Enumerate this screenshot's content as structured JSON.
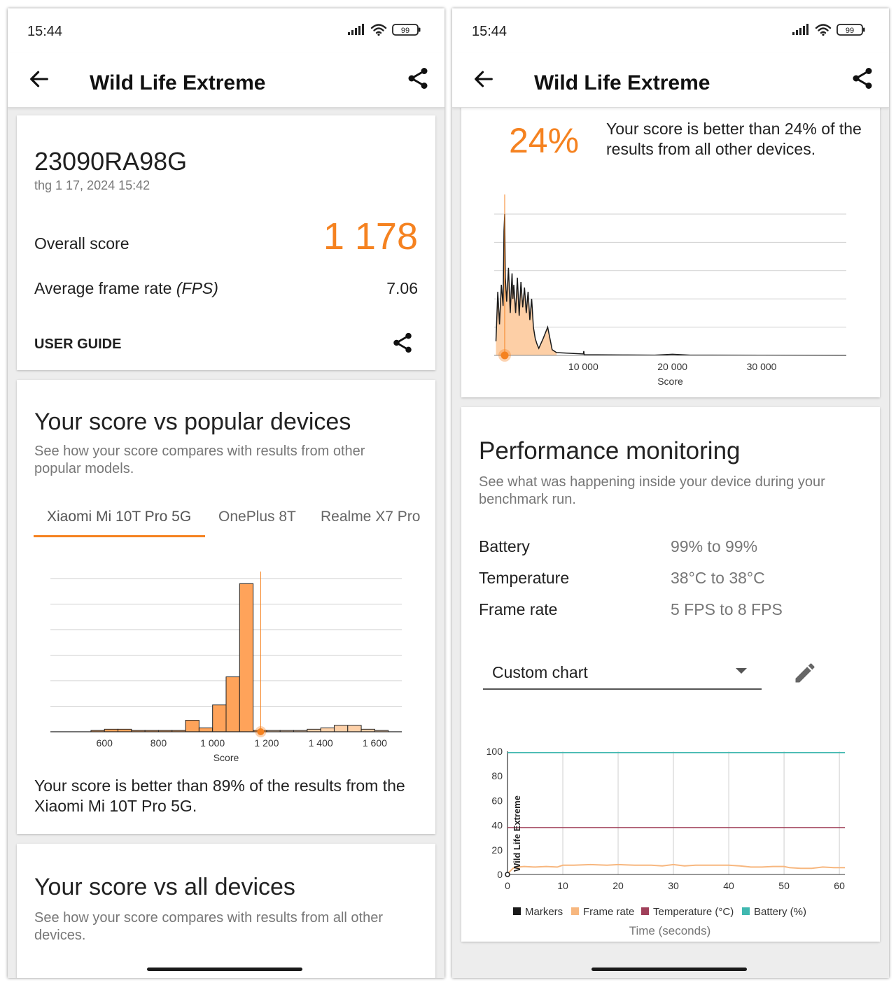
{
  "status": {
    "time": "15:44",
    "battery": "99"
  },
  "app": {
    "title": "Wild Life Extreme"
  },
  "result": {
    "device": "23090RA98G",
    "date": "thg 1 17, 2024 15:42",
    "overall_label": "Overall score",
    "overall_value": "1 178",
    "fps_label": "Average frame rate",
    "fps_unit": "(FPS)",
    "fps_value": "7.06",
    "user_guide": "USER GUIDE"
  },
  "popular": {
    "title": "Your score vs popular devices",
    "description": "See how your score compares with results from other popular models.",
    "tabs": [
      "Xiaomi Mi 10T Pro 5G",
      "OnePlus 8T",
      "Realme X7 Pro"
    ],
    "active_tab": 0,
    "summary": "Your score is better than 89% of the results from the Xiaomi Mi 10T Pro 5G."
  },
  "all_devices": {
    "title": "Your score vs all devices",
    "description": "See how your score compares with results from all other devices.",
    "percent": "24%",
    "summary": "Your score is better than 24% of the results from all other devices."
  },
  "performance": {
    "title": "Performance monitoring",
    "description": "See what was happening inside your device during your benchmark run.",
    "rows": [
      {
        "label": "Battery",
        "value": "99% to 99%"
      },
      {
        "label": "Temperature",
        "value": "38°C to 38°C"
      },
      {
        "label": "Frame rate",
        "value": "5 FPS to 8 FPS"
      }
    ],
    "dropdown_value": "Custom chart"
  },
  "colors": {
    "accent": "#f58220",
    "bar_fill": "#ffa35a",
    "temperature": "#a0405a",
    "battery": "#40b8b0",
    "framerate": "#f7b77f",
    "markers": "#1a1a1a"
  },
  "chart_data": [
    {
      "type": "bar",
      "xlabel": "Score",
      "x_ticks": [
        600,
        800,
        1000,
        1200,
        1400,
        1600
      ],
      "bin_width": 50,
      "bins": [
        {
          "x": 425,
          "v": 0
        },
        {
          "x": 475,
          "v": 0
        },
        {
          "x": 525,
          "v": 0
        },
        {
          "x": 575,
          "v": 0.5
        },
        {
          "x": 625,
          "v": 1
        },
        {
          "x": 675,
          "v": 1
        },
        {
          "x": 725,
          "v": 0.5
        },
        {
          "x": 775,
          "v": 0.5
        },
        {
          "x": 825,
          "v": 0.5
        },
        {
          "x": 875,
          "v": 0.5
        },
        {
          "x": 925,
          "v": 4.5
        },
        {
          "x": 975,
          "v": 1.5
        },
        {
          "x": 1025,
          "v": 10.5
        },
        {
          "x": 1075,
          "v": 21.5
        },
        {
          "x": 1125,
          "v": 58
        },
        {
          "x": 1175,
          "v": 0.5
        },
        {
          "x": 1225,
          "v": 0.5
        },
        {
          "x": 1275,
          "v": 0.5
        },
        {
          "x": 1325,
          "v": 0.5
        },
        {
          "x": 1375,
          "v": 1
        },
        {
          "x": 1425,
          "v": 1.5
        },
        {
          "x": 1475,
          "v": 2.5
        },
        {
          "x": 1525,
          "v": 2.5
        },
        {
          "x": 1575,
          "v": 1
        },
        {
          "x": 1625,
          "v": 0.5
        },
        {
          "x": 1675,
          "v": 0
        }
      ],
      "xlim": [
        400,
        1700
      ],
      "ylim": [
        0,
        60
      ],
      "marker_score": 1178,
      "grid": true
    },
    {
      "type": "line",
      "xlabel": "Score",
      "x_ticks": [
        10000,
        20000,
        30000
      ],
      "xlim": [
        0,
        39500
      ],
      "ylim": [
        0,
        100
      ],
      "marker_score": 1178,
      "x": [
        200,
        400,
        600,
        800,
        1000,
        1100,
        1178,
        1250,
        1400,
        1600,
        1800,
        2000,
        2100,
        2200,
        2400,
        2600,
        2800,
        3000,
        3200,
        3400,
        3600,
        3800,
        4000,
        4200,
        4400,
        4600,
        4800,
        5000,
        5500,
        6000,
        6500,
        7000,
        10000,
        10050,
        10100,
        15000,
        18000,
        20000,
        22000,
        30000,
        39500
      ],
      "y": [
        10,
        45,
        22,
        50,
        35,
        88,
        100,
        55,
        38,
        62,
        30,
        58,
        40,
        50,
        30,
        55,
        28,
        52,
        34,
        48,
        30,
        45,
        25,
        40,
        20,
        12,
        8,
        5,
        12,
        20,
        4,
        2,
        1,
        3,
        0.5,
        0.3,
        0.2,
        0.8,
        0.2,
        0.1,
        0
      ],
      "grid": true
    },
    {
      "type": "line",
      "xlabel": "Time (seconds)",
      "x_ticks": [
        0,
        10,
        20,
        30,
        40,
        50,
        60
      ],
      "y_ticks": [
        0,
        20,
        40,
        60,
        80,
        100
      ],
      "xlim": [
        0,
        61
      ],
      "ylim": [
        0,
        100
      ],
      "marker_label": "Wild Life Extreme",
      "legend": [
        "Markers",
        "Frame rate",
        "Temperature (°C)",
        "Battery (%)"
      ],
      "series": [
        {
          "name": "Battery (%)",
          "x": [
            0,
            61
          ],
          "values": [
            99,
            99
          ]
        },
        {
          "name": "Temperature (°C)",
          "x": [
            0,
            61
          ],
          "values": [
            38,
            38
          ]
        },
        {
          "name": "Frame rate",
          "x": [
            0,
            1,
            2,
            3,
            5,
            7,
            9,
            10,
            12,
            15,
            18,
            20,
            23,
            26,
            28,
            30,
            32,
            34,
            37,
            40,
            42,
            44,
            46,
            48,
            50,
            51,
            53,
            55,
            57,
            59,
            61
          ],
          "values": [
            0.5,
            5,
            6,
            6.5,
            6,
            6.5,
            6,
            7.5,
            7.5,
            8,
            7.5,
            8,
            7.5,
            7.5,
            7,
            8,
            7,
            7.5,
            7.5,
            7.5,
            7,
            6,
            6,
            6.5,
            6.5,
            5.5,
            5,
            5,
            6,
            5.5,
            5.5
          ]
        }
      ]
    }
  ]
}
